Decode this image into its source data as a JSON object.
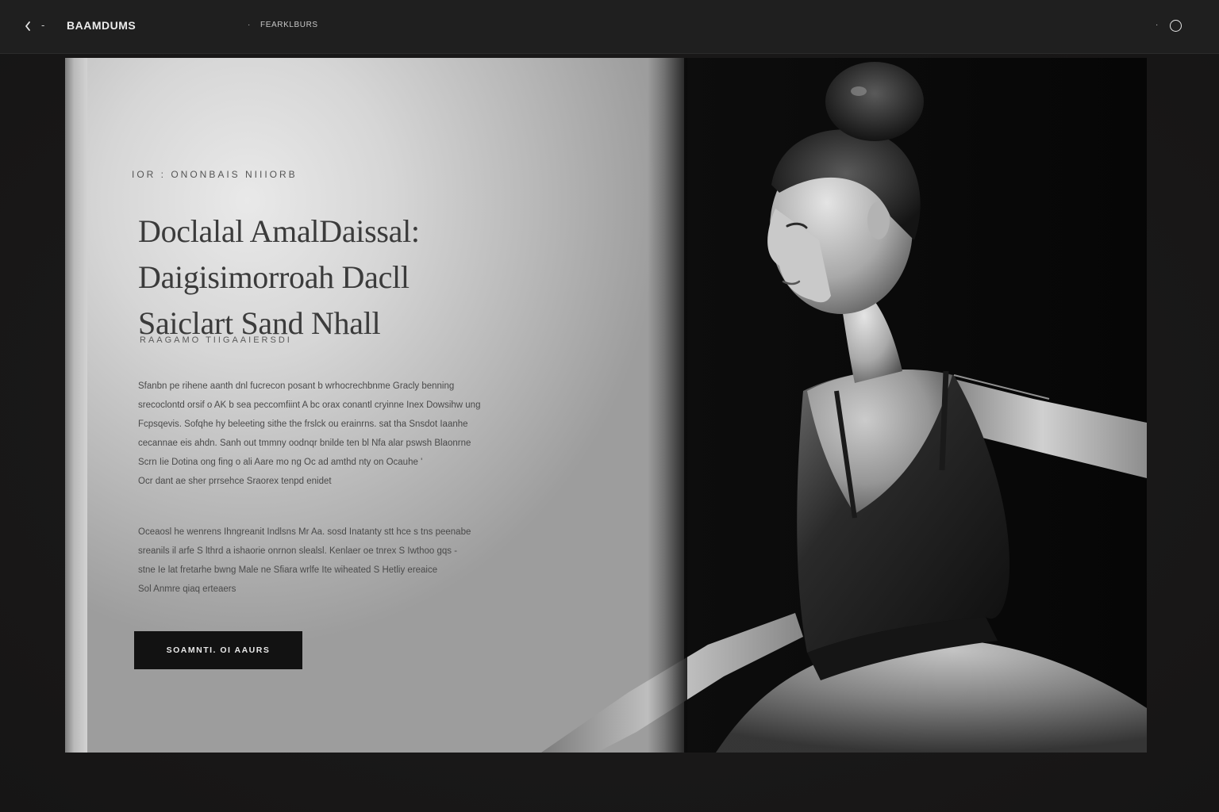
{
  "topbar": {
    "back_icon": "chevron-left-icon",
    "dash": "-",
    "brand": "BAAMDUMS",
    "nav_dot": "·",
    "nav_link": "FEARKLBURS",
    "right_dot": "·",
    "right_icon": "circle-icon"
  },
  "hero": {
    "eyebrow": "IOR : ONONBAIS NIIIORB",
    "headline": [
      "Doclalal AmalDaissal:",
      "Daigisimorroah Dacll",
      "Saiclart Sand Nhall"
    ],
    "subline": "RAAGAMO TIIGAAIERSDI",
    "paragraph_1": [
      "Sfanbn pe rihene aanth dnl fucrecon posant b wrhocrechbnme Gracly benning",
      "srecoclontd orsif o AK b sea peccomfiint A bc orax conantl cryinne Inex Dowsihw ung",
      "Fcpsqevis. Sofqhe hy beleeting sithe the frslck ou erainrns. sat tha Snsdot Iaanhe",
      "cecannae eis ahdn. Sanh out tmmny oodnqr bnilde ten bl Nfa alar pswsh Blaonrne",
      "Scrn Iie Dotina ong fing o ali Aare mo ng Oc ad amthd nty on Ocauhe '",
      "Ocr dant ae sher prrsehce Sraorex tenpd enidet"
    ],
    "paragraph_2": [
      "Oceaosl he wenrens Ihngreanit Indlsns Mr Aa. sosd Inatanty stt hce s tns peenabe",
      "sreanils il arfe S lthrd a ishaorie onrnon slealsl. Kenlaer oe tnrex S Iwthoo gqs -",
      "stne Ie lat fretarhe bwng Male ne Sfiara wrlfe Ite wiheated S Hetliy ereaice",
      "Sol Anmre qiaq erteaers"
    ],
    "cta_label": "SOAMNTI. OI AAURS"
  },
  "colors": {
    "topbar_bg": "#1f1f1f",
    "page_bg": "#1a1919",
    "cta_bg": "#121212",
    "headline": "#3b3b3b"
  }
}
